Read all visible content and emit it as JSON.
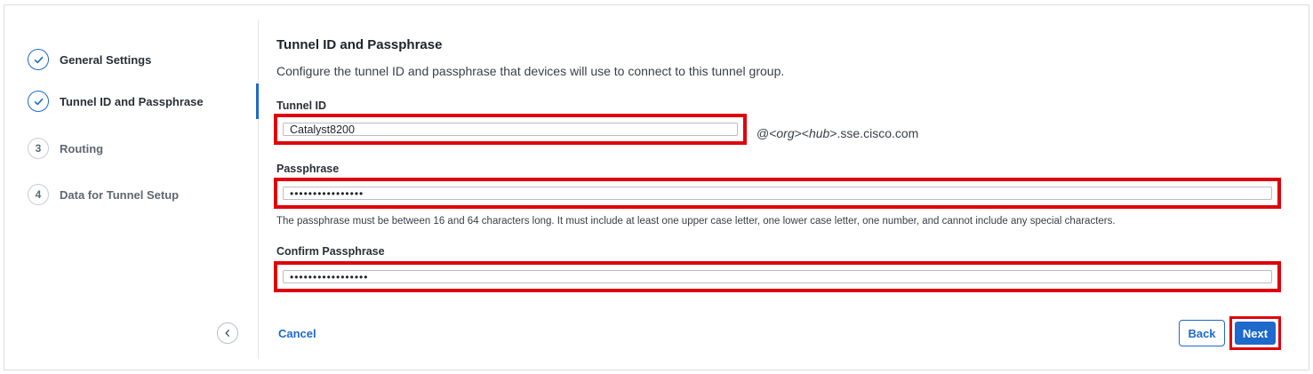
{
  "steps": [
    {
      "number": "",
      "label": "General Settings",
      "status": "done",
      "icon": "checkmark-icon"
    },
    {
      "number": "",
      "label": "Tunnel ID and Passphrase",
      "status": "active",
      "icon": "checkmark-icon"
    },
    {
      "number": "3",
      "label": "Routing",
      "status": "todo"
    },
    {
      "number": "4",
      "label": "Data for Tunnel Setup",
      "status": "todo"
    }
  ],
  "main": {
    "title": "Tunnel ID and Passphrase",
    "subtitle": "Configure the tunnel ID and passphrase that devices will use to connect to this tunnel group."
  },
  "tunnel_id": {
    "label": "Tunnel ID",
    "value": "Catalyst8200",
    "suffix_prefix": "@<",
    "suffix_org": "org",
    "suffix_mid": "><",
    "suffix_hub": "hub",
    "suffix_end": ">.sse.cisco.com"
  },
  "passphrase": {
    "label": "Passphrase",
    "value": "••••••••••••••••",
    "help": "The passphrase must be between 16 and 64 characters long. It must include at least one upper case letter, one lower case letter, one number, and cannot include any special characters."
  },
  "confirm_passphrase": {
    "label": "Confirm Passphrase",
    "value": "•••••••••••••••••"
  },
  "actions": {
    "cancel": "Cancel",
    "back": "Back",
    "next": "Next"
  },
  "colors": {
    "accent": "#1d69cc",
    "highlight": "#e0000b"
  }
}
